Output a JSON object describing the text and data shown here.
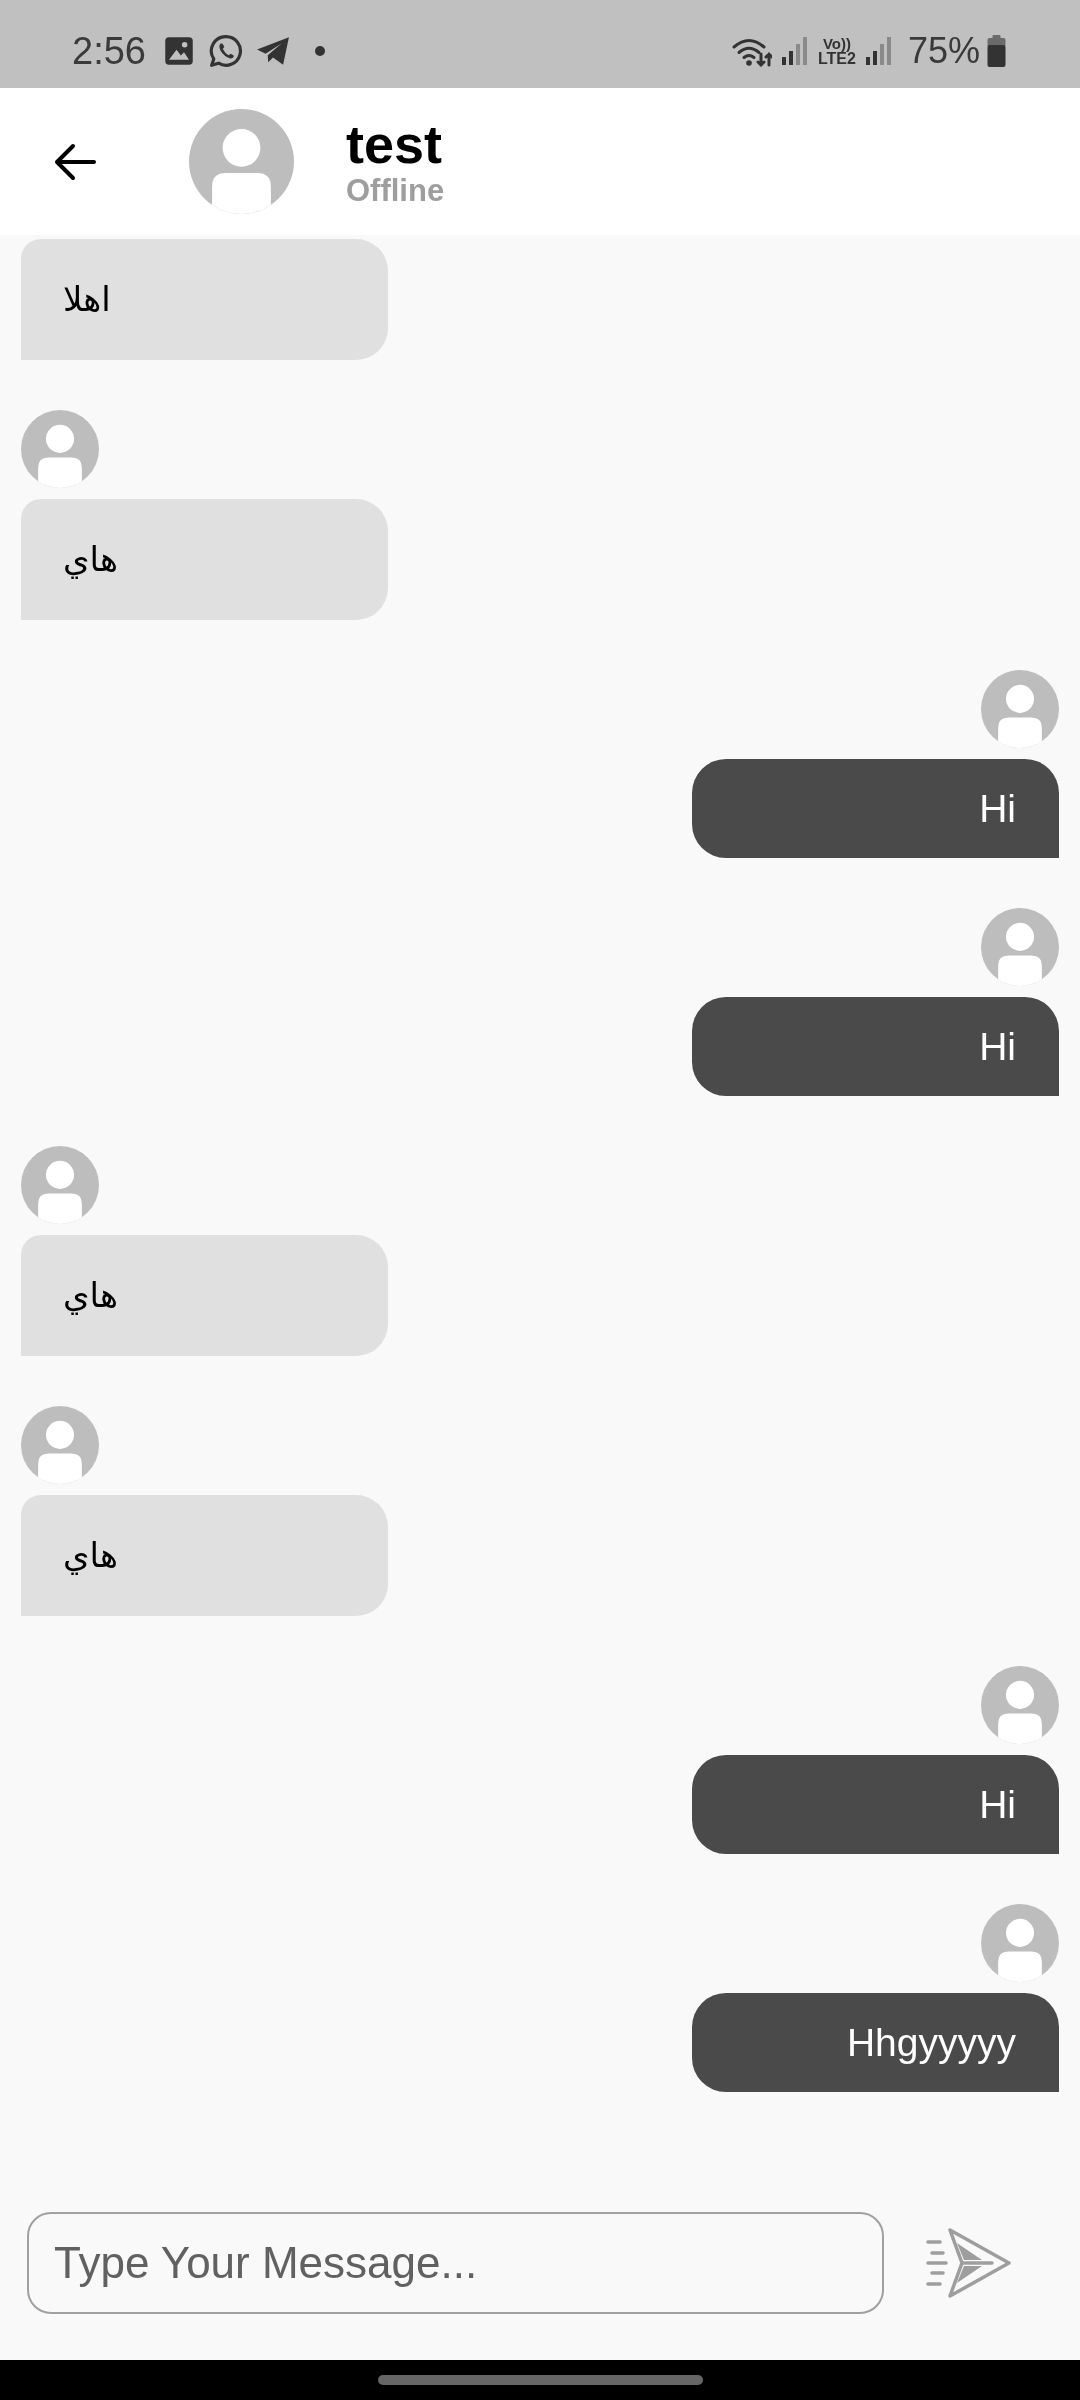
{
  "status_bar": {
    "time": "2:56",
    "network_top": "Vo))",
    "network_bottom": "LTE2",
    "battery": "75%"
  },
  "header": {
    "title": "test",
    "status": "Offline"
  },
  "messages": [
    {
      "kind": "received",
      "avatar": false,
      "text": "اهلا"
    },
    {
      "kind": "received",
      "avatar": true,
      "text": "هاي"
    },
    {
      "kind": "sent",
      "avatar": true,
      "text": "Hi"
    },
    {
      "kind": "sent",
      "avatar": true,
      "text": "Hi"
    },
    {
      "kind": "received",
      "avatar": true,
      "text": "هاي"
    },
    {
      "kind": "received",
      "avatar": true,
      "text": "هاي"
    },
    {
      "kind": "sent",
      "avatar": true,
      "text": "Hi"
    },
    {
      "kind": "sent",
      "avatar": true,
      "text": "Hhgyyyyy"
    }
  ],
  "composer": {
    "placeholder": "Type Your Message..."
  }
}
